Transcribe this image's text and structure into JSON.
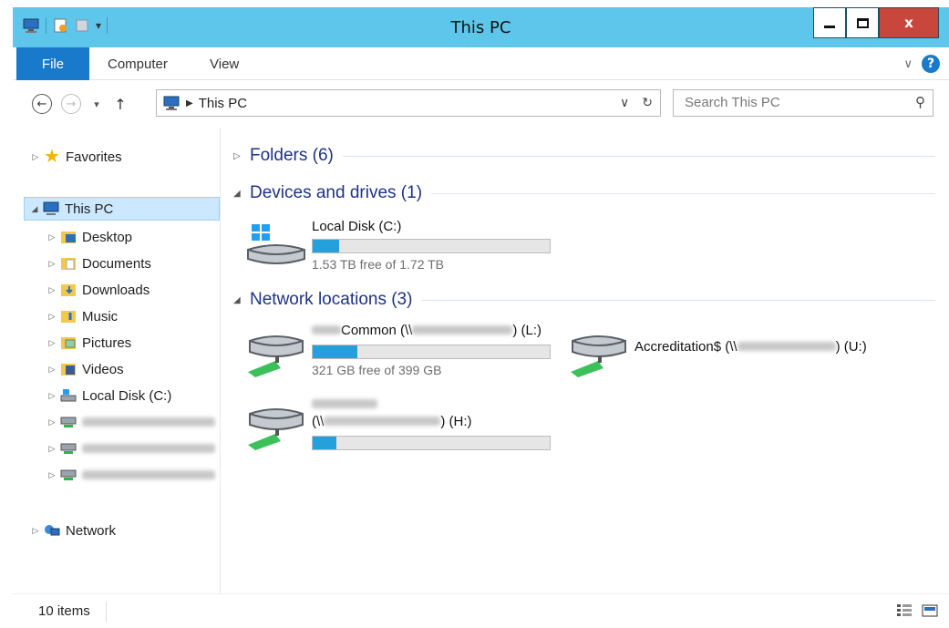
{
  "window": {
    "title": "This PC",
    "close_label": "x"
  },
  "ribbon": {
    "tabs": [
      {
        "label": "File"
      },
      {
        "label": "Computer"
      },
      {
        "label": "View"
      }
    ],
    "help_label": "?"
  },
  "navbar": {
    "address": "This PC",
    "search_placeholder": "Search This PC"
  },
  "nav_pane": {
    "favorites": "Favorites",
    "this_pc": "This PC",
    "children": [
      {
        "label": "Desktop",
        "icon": "desktop-folder-icon"
      },
      {
        "label": "Documents",
        "icon": "documents-folder-icon"
      },
      {
        "label": "Downloads",
        "icon": "downloads-folder-icon"
      },
      {
        "label": "Music",
        "icon": "music-folder-icon"
      },
      {
        "label": "Pictures",
        "icon": "pictures-folder-icon"
      },
      {
        "label": "Videos",
        "icon": "videos-folder-icon"
      },
      {
        "label": "Local Disk (C:)",
        "icon": "local-disk-icon"
      }
    ],
    "network": "Network"
  },
  "main": {
    "groups": {
      "folders": "Folders (6)",
      "devices": "Devices and drives (1)",
      "network": "Network locations (3)"
    },
    "drives": {
      "local_c": {
        "name": "Local Disk (C:)",
        "free_text": "1.53 TB free of 1.72 TB",
        "used_fraction": 0.11
      },
      "net_l": {
        "name_suffix": "Common (\\\\",
        "letter": ") (L:)",
        "free_text": "321 GB free of 399 GB",
        "used_fraction": 0.19
      },
      "net_u": {
        "name_prefix": "Accreditation$ (\\\\",
        "letter": ") (U:)"
      },
      "net_h": {
        "name_prefix": "(\\\\",
        "letter": ") (H:)",
        "used_fraction": 0.1
      }
    }
  },
  "status": {
    "item_count": "10 items"
  },
  "colors": {
    "titlebar": "#5ec6ea",
    "file_tab": "#1979ca",
    "group_title": "#1e3287",
    "drive_fill": "#26a0da",
    "close_button": "#c9463d",
    "selection": "#cce8ff"
  }
}
